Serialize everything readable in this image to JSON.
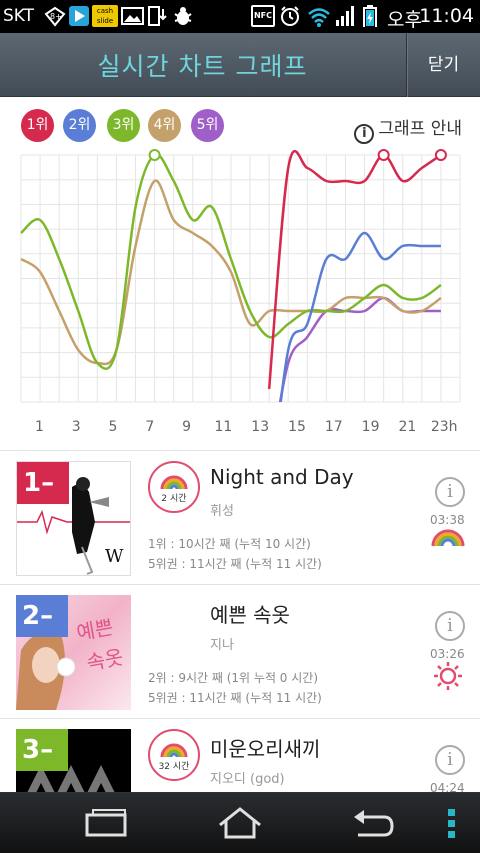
{
  "status": {
    "carrier": "SKT",
    "badge": "8+",
    "cash_slide": "cash slide",
    "nfc": "NFC",
    "ampm": "오후",
    "time": "11:04"
  },
  "header": {
    "title": "실시간 차트 그래프",
    "close_label": "닫기"
  },
  "chart": {
    "rank_chips": [
      {
        "label": "1위",
        "color": "#d6294e"
      },
      {
        "label": "2위",
        "color": "#5a7ed6"
      },
      {
        "label": "3위",
        "color": "#7db82b"
      },
      {
        "label": "4위",
        "color": "#c4a06a"
      },
      {
        "label": "5위",
        "color": "#a05ec8"
      }
    ],
    "guide_label": "그래프 안내"
  },
  "chart_data": {
    "type": "line",
    "x": [
      0,
      1,
      2,
      3,
      4,
      5,
      6,
      7,
      8,
      9,
      10,
      11,
      12,
      13,
      14,
      15,
      16,
      17,
      18,
      19,
      20,
      21,
      22,
      23
    ],
    "xticks": [
      "1",
      "3",
      "5",
      "7",
      "9",
      "11",
      "13",
      "15",
      "17",
      "19",
      "21",
      "23h"
    ],
    "series": [
      {
        "color": "#d6294e",
        "values": [
          null,
          null,
          null,
          null,
          null,
          null,
          null,
          null,
          null,
          null,
          null,
          null,
          null,
          19,
          2,
          2,
          3,
          3,
          3,
          1,
          3,
          2,
          1,
          null
        ]
      },
      {
        "color": "#5a7ed6",
        "values": [
          null,
          null,
          null,
          null,
          null,
          null,
          null,
          null,
          null,
          null,
          null,
          null,
          null,
          28,
          16,
          14,
          9,
          9,
          7,
          9,
          8,
          8,
          8,
          null
        ]
      },
      {
        "color": "#7db82b",
        "values": [
          7,
          6,
          9,
          13,
          17,
          16,
          5,
          1,
          3,
          6,
          5,
          9,
          13,
          15,
          14,
          13,
          13,
          13,
          12,
          11,
          12,
          12,
          11,
          null
        ]
      },
      {
        "color": "#c4a06a",
        "values": [
          9,
          10,
          13,
          16,
          17,
          16,
          8,
          3,
          6,
          7,
          8,
          10,
          14,
          13,
          13,
          13,
          13,
          12,
          12,
          12,
          13,
          13,
          12,
          null
        ]
      },
      {
        "color": "#a05ec8",
        "values": [
          null,
          null,
          null,
          null,
          null,
          null,
          null,
          null,
          null,
          null,
          null,
          null,
          null,
          25,
          17,
          15,
          13,
          13,
          13,
          12,
          13,
          13,
          13,
          null
        ]
      }
    ],
    "ylim": [
      1,
      20
    ],
    "grid": true
  },
  "list": [
    {
      "rank": "1",
      "rank_color": "#d6294e",
      "badge_label": "2 시간",
      "song": "Night and Day",
      "artist": "휘성",
      "stat1": "1위 : 10시간 째 (누적 10 시간)",
      "stat2": "5위권 : 11시간 째 (누적 11 시간)",
      "duration": "03:38",
      "weather": "rainbow-icon"
    },
    {
      "rank": "2",
      "rank_color": "#5a7ed6",
      "badge_label": "",
      "song": "예쁜 속옷",
      "artist": "지나",
      "stat1": "2위 : 9시간 째 (1위 누적 0 시간)",
      "stat2": "5위권 : 11시간 째 (누적 11 시간)",
      "duration": "03:26",
      "weather": "sun-icon"
    },
    {
      "rank": "3",
      "rank_color": "#7db82b",
      "badge_label": "32 시간",
      "song": "미운오리새끼",
      "artist": "지오디 (god)",
      "stat1": "",
      "stat2": "",
      "duration": "04:24",
      "weather": ""
    }
  ]
}
